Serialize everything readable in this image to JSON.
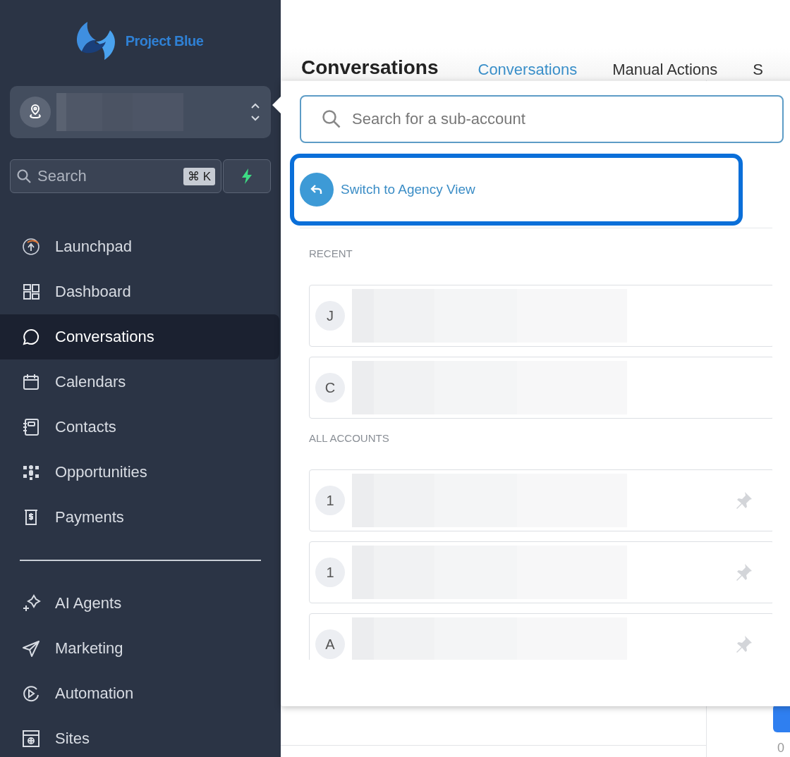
{
  "brand": {
    "name": "Project Blue"
  },
  "sidebar": {
    "search": {
      "placeholder": "Search",
      "shortcut": "⌘ K"
    },
    "primary_items": [
      {
        "label": "Launchpad",
        "selected": false
      },
      {
        "label": "Dashboard",
        "selected": false
      },
      {
        "label": "Conversations",
        "selected": true
      },
      {
        "label": "Calendars",
        "selected": false
      },
      {
        "label": "Contacts",
        "selected": false
      },
      {
        "label": "Opportunities",
        "selected": false
      },
      {
        "label": "Payments",
        "selected": false
      }
    ],
    "secondary_items": [
      {
        "label": "AI Agents",
        "selected": false
      },
      {
        "label": "Marketing",
        "selected": false
      },
      {
        "label": "Automation",
        "selected": false
      },
      {
        "label": "Sites",
        "selected": false
      }
    ]
  },
  "header": {
    "title": "Conversations",
    "tabs": [
      {
        "label": "Conversations",
        "selected": true
      },
      {
        "label": "Manual Actions",
        "selected": false
      },
      {
        "label": "S",
        "selected": false
      }
    ]
  },
  "account_menu": {
    "search": {
      "placeholder": "Search for a sub-account"
    },
    "switch_link": {
      "label": "Switch to Agency View",
      "highlighted": true
    },
    "sections": [
      {
        "heading": "RECENT",
        "accounts": [
          {
            "initial": "J",
            "pin": false
          },
          {
            "initial": "C",
            "pin": false
          }
        ]
      },
      {
        "heading": "ALL ACCOUNTS",
        "accounts": [
          {
            "initial": "1",
            "pin": true
          },
          {
            "initial": "1",
            "pin": true
          },
          {
            "initial": "A",
            "pin": true
          }
        ]
      }
    ]
  },
  "main_peek": {
    "text": "0"
  }
}
